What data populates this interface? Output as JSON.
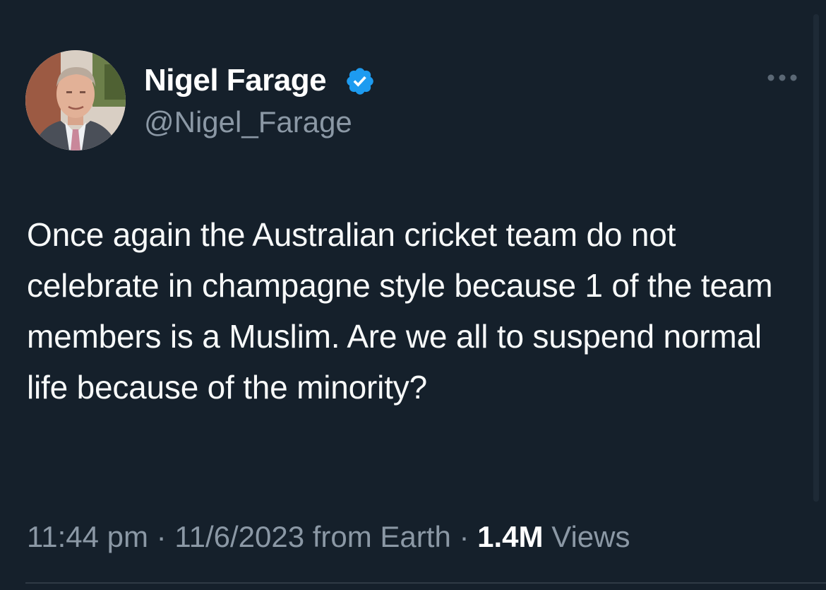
{
  "tweet": {
    "author": {
      "display_name": "Nigel Farage",
      "handle": "@Nigel_Farage",
      "verified": true
    },
    "text": "Once again the Australian cricket team do not celebrate in champagne style because 1 of the team members is a Muslim. Are we all to suspend normal life because of the minority?",
    "time": "11:44 pm",
    "date": "11/6/2023",
    "source": "from Earth",
    "separator": "·",
    "views_count": "1.4M",
    "views_label": "Views"
  },
  "icons": {
    "verified": "verified-badge-icon",
    "more": "more-options-icon"
  },
  "colors": {
    "background": "#15202b",
    "primary_text": "#f7f9f9",
    "secondary_text": "#8b98a5",
    "verified_blue": "#1d9bf0"
  }
}
